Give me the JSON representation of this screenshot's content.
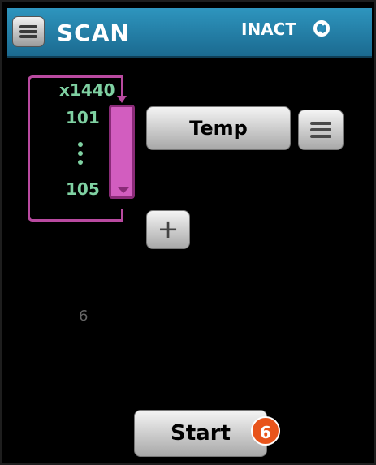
{
  "header": {
    "title": "SCAN",
    "status": "INACT",
    "status_icon": "refresh-icon",
    "menu_icon": "menu-icon",
    "background_color": "#2a8cb8"
  },
  "loop": {
    "count": "x1440",
    "channel_start": "101",
    "channel_end": "105",
    "color": "#b94aa0",
    "text_color": "#7fd1a2"
  },
  "temp_button": {
    "label": "Temp"
  },
  "list_button": {
    "icon": "list-icon"
  },
  "add_button": {
    "label": "+"
  },
  "step_count": "6",
  "start_button": {
    "label": "Start"
  },
  "callout": {
    "number": "6",
    "color": "#e8541b"
  }
}
